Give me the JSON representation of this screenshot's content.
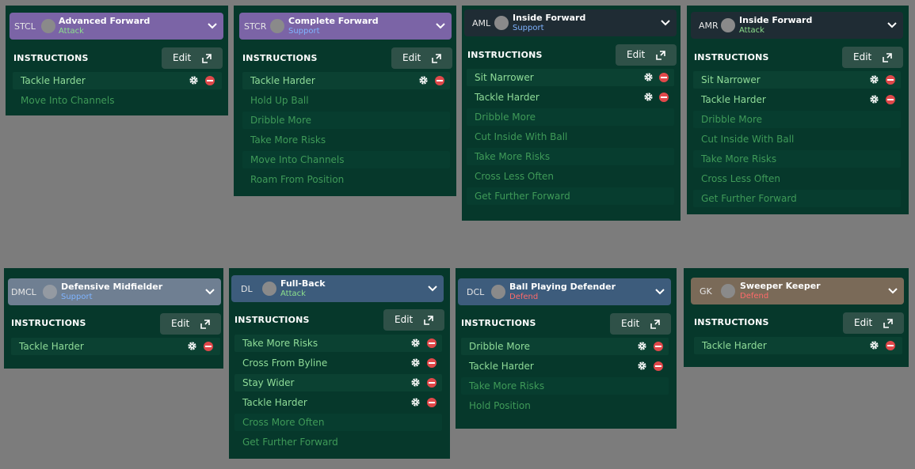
{
  "colors": {
    "background": "#7c7c7c",
    "card": "#06382b",
    "attack_text": "#8de08c",
    "support_text": "#7fb4ff",
    "defend_text": "#ff6a6a",
    "remove_red": "#e0484a"
  },
  "panels": [
    {
      "position": "STCL",
      "role": "Advanced Forward",
      "duty": "Attack",
      "instructions_label": "INSTRUCTIONS",
      "edit_label": "Edit",
      "rows": [
        {
          "label": "Tackle Harder",
          "active": true
        },
        {
          "label": "Move Into Channels",
          "active": false
        }
      ]
    },
    {
      "position": "STCR",
      "role": "Complete Forward",
      "duty": "Support",
      "instructions_label": "INSTRUCTIONS",
      "edit_label": "Edit",
      "rows": [
        {
          "label": "Tackle Harder",
          "active": true
        },
        {
          "label": "Hold Up Ball",
          "active": false
        },
        {
          "label": "Dribble More",
          "active": false
        },
        {
          "label": "Take More Risks",
          "active": false
        },
        {
          "label": "Move Into Channels",
          "active": false
        },
        {
          "label": "Roam From Position",
          "active": false
        }
      ]
    },
    {
      "position": "AML",
      "role": "Inside Forward",
      "duty": "Support",
      "instructions_label": "INSTRUCTIONS",
      "edit_label": "Edit",
      "rows": [
        {
          "label": "Sit Narrower",
          "active": true
        },
        {
          "label": "Tackle Harder",
          "active": true
        },
        {
          "label": "Dribble More",
          "active": false
        },
        {
          "label": "Cut Inside With Ball",
          "active": false
        },
        {
          "label": "Take More Risks",
          "active": false
        },
        {
          "label": "Cross Less Often",
          "active": false
        },
        {
          "label": "Get Further Forward",
          "active": false
        }
      ]
    },
    {
      "position": "AMR",
      "role": "Inside Forward",
      "duty": "Attack",
      "instructions_label": "INSTRUCTIONS",
      "edit_label": "Edit",
      "rows": [
        {
          "label": "Sit Narrower",
          "active": true
        },
        {
          "label": "Tackle Harder",
          "active": true
        },
        {
          "label": "Dribble More",
          "active": false
        },
        {
          "label": "Cut Inside With Ball",
          "active": false
        },
        {
          "label": "Take More Risks",
          "active": false
        },
        {
          "label": "Cross Less Often",
          "active": false
        },
        {
          "label": "Get Further Forward",
          "active": false
        }
      ]
    },
    {
      "position": "DMCL",
      "role": "Defensive Midfielder",
      "duty": "Support",
      "instructions_label": "INSTRUCTIONS",
      "edit_label": "Edit",
      "rows": [
        {
          "label": "Tackle Harder",
          "active": true
        }
      ]
    },
    {
      "position": "DL",
      "role": "Full-Back",
      "duty": "Attack",
      "instructions_label": "INSTRUCTIONS",
      "edit_label": "Edit",
      "rows": [
        {
          "label": "Take More Risks",
          "active": true
        },
        {
          "label": "Cross From Byline",
          "active": true
        },
        {
          "label": "Stay Wider",
          "active": true
        },
        {
          "label": "Tackle Harder",
          "active": true
        },
        {
          "label": "Cross More Often",
          "active": false
        },
        {
          "label": "Get Further Forward",
          "active": false
        }
      ]
    },
    {
      "position": "DCL",
      "role": "Ball Playing Defender",
      "duty": "Defend",
      "instructions_label": "INSTRUCTIONS",
      "edit_label": "Edit",
      "rows": [
        {
          "label": "Dribble More",
          "active": true
        },
        {
          "label": "Tackle Harder",
          "active": true
        },
        {
          "label": "Take More Risks",
          "active": false
        },
        {
          "label": "Hold Position",
          "active": false
        }
      ]
    },
    {
      "position": "GK",
      "role": "Sweeper Keeper",
      "duty": "Defend",
      "instructions_label": "INSTRUCTIONS",
      "edit_label": "Edit",
      "rows": [
        {
          "label": "Tackle Harder",
          "active": true
        }
      ]
    }
  ]
}
